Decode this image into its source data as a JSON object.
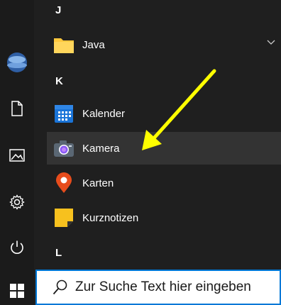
{
  "sections": {
    "j": "J",
    "k": "K",
    "l": "L"
  },
  "apps": {
    "java": {
      "label": "Java",
      "icon": "folder-icon"
    },
    "kalender": {
      "label": "Kalender",
      "icon": "calendar-icon"
    },
    "kamera": {
      "label": "Kamera",
      "icon": "camera-icon"
    },
    "karten": {
      "label": "Karten",
      "icon": "map-pin-icon"
    },
    "kurznotizen": {
      "label": "Kurznotizen",
      "icon": "sticky-note-icon"
    }
  },
  "search": {
    "placeholder": "Zur Suche Text hier eingeben"
  },
  "rail": {
    "items": [
      "avatar",
      "document-icon",
      "pictures-icon",
      "gear-icon",
      "power-icon",
      "windows-start-icon"
    ]
  },
  "colors": {
    "accent": "#0078d7",
    "arrow": "#ffff00",
    "folder": "#ffc83d",
    "calendar": "#1a74d8",
    "maps": "#e74c1c",
    "sticky": "#f7c11e"
  }
}
